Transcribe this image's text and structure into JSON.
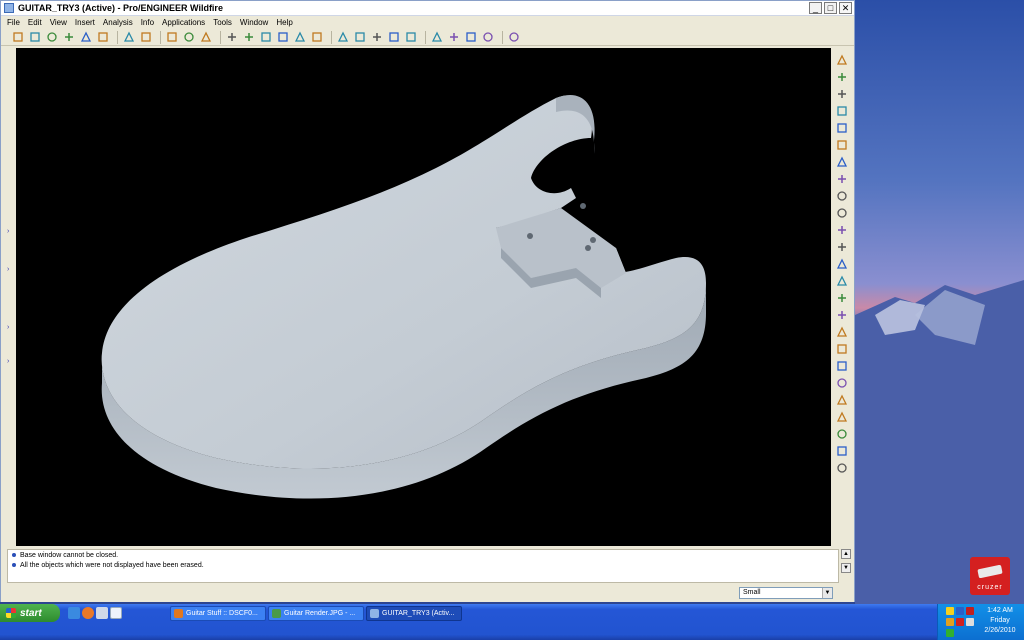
{
  "window": {
    "title": "GUITAR_TRY3 (Active) - Pro/ENGINEER Wildfire",
    "controls": [
      "_",
      "□",
      "✕"
    ]
  },
  "menu": [
    "File",
    "Edit",
    "View",
    "Insert",
    "Analysis",
    "Info",
    "Applications",
    "Tools",
    "Window",
    "Help"
  ],
  "toolbar_icons": [
    "new-icon",
    "open-icon",
    "save-icon",
    "print-icon",
    "email-icon",
    "send-icon",
    "cut-icon",
    "binoculars-icon",
    "select-box-icon",
    "repaint-icon",
    "spin-center-icon",
    "orient-icon",
    "zoom-in-icon",
    "zoom-out-icon",
    "refit-icon",
    "reorient-icon",
    "saved-views-icon",
    "layers-icon",
    "wireframe-icon",
    "hidden-line-icon",
    "no-hidden-icon",
    "shading-icon",
    "datum-plane-icon",
    "datum-axis-icon",
    "datum-point-icon",
    "coord-sys-icon",
    "context-help-icon"
  ],
  "right_toolbar_icons": [
    "plane-icon",
    "axis-icon",
    "curve-icon",
    "point-icon",
    "datum-point-array-icon",
    "csys-icon",
    "analysis-icon",
    "extrude-icon",
    "revolve-icon",
    "variable-sweep-icon",
    "blend-icon",
    "style-icon",
    "hole-icon",
    "shell-icon",
    "rib-icon",
    "draft-icon",
    "round-icon",
    "chamfer-icon",
    "pattern-icon",
    "mirror-icon",
    "merge-icon",
    "trim-icon",
    "offset-icon",
    "thicken-icon",
    "solidify-icon"
  ],
  "messages": [
    "Base window cannot be closed.",
    "All the objects which were not displayed have been erased."
  ],
  "filter": {
    "value": "Small"
  },
  "taskbar": {
    "start_label": "start",
    "tasks": [
      {
        "label": "Guitar Stuff :: DSCF0...",
        "color": "#e07820"
      },
      {
        "label": "Guitar Render.JPG - ...",
        "color": "#4a9a4a"
      },
      {
        "label": "GUITAR_TRY3 (Activ...",
        "color": "#8fb3e6"
      }
    ],
    "clock": {
      "time": "1:42 AM",
      "day": "Friday",
      "date": "2/26/2010"
    }
  },
  "cruzer": {
    "label": "cruzer"
  },
  "colors": {
    "viewport_bg": "#000000",
    "model": "#c6ced6",
    "taskbar": "#2254d0"
  }
}
